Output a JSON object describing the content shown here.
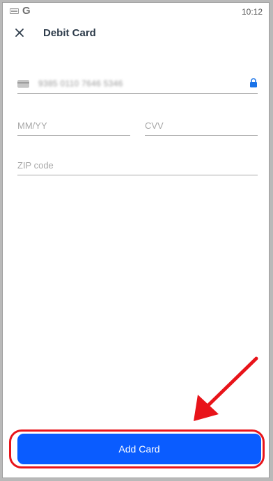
{
  "status_bar": {
    "time": "10:12",
    "icons": [
      "keyboard-icon",
      "google-g-icon"
    ]
  },
  "app_bar": {
    "title": "Debit Card",
    "close_icon": "close-icon"
  },
  "form": {
    "card_number": {
      "value": "9385 0110 7646 5346",
      "icons": [
        "card-icon",
        "lock-icon"
      ]
    },
    "expiry": {
      "placeholder": "MM/YY"
    },
    "cvv": {
      "placeholder": "CVV"
    },
    "zip": {
      "placeholder": "ZIP code"
    }
  },
  "actions": {
    "add_card_label": "Add Card"
  },
  "colors": {
    "primary": "#0a5cff",
    "title": "#2d3b4a",
    "annotation": "#e8141a",
    "lock": "#1a73e8"
  }
}
